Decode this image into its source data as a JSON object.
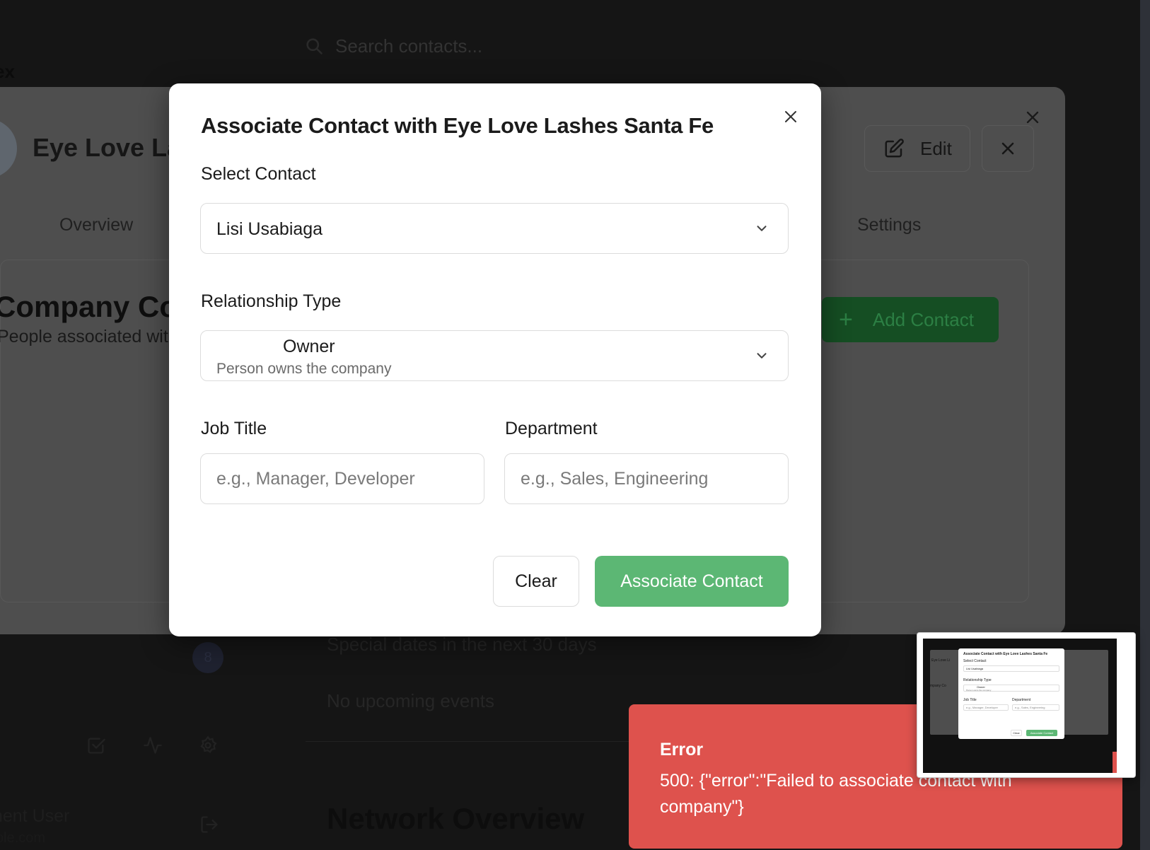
{
  "background": {
    "search_placeholder": "Search contacts...",
    "brand": "ex",
    "company_name": "Eye Love Las",
    "edit_label": "Edit",
    "tabs": [
      {
        "label": "Overview"
      },
      {
        "label": "Settings"
      }
    ],
    "section_title": "Company Co",
    "section_subtitle": "People associated wit",
    "add_contact_label": "Add Contact",
    "badge_count": "8",
    "special_dates_text": "Special dates in the next 30 days",
    "no_events_text": "No upcoming events",
    "network_title": "Network Overview",
    "user_name": "nent User",
    "user_email": "ple.com"
  },
  "modal": {
    "title": "Associate Contact with Eye Love Lashes Santa Fe",
    "select_contact_label": "Select Contact",
    "selected_contact": "Lisi Usabiaga",
    "relationship_type_label": "Relationship Type",
    "relationship_value": "Owner",
    "relationship_description": "Person owns the company",
    "job_title_label": "Job Title",
    "job_title_placeholder": "e.g., Manager, Developer",
    "job_title_value": "",
    "department_label": "Department",
    "department_placeholder": "e.g., Sales, Engineering",
    "department_value": "",
    "clear_label": "Clear",
    "associate_label": "Associate Contact"
  },
  "toast": {
    "title": "Error",
    "message": "500: {\"error\":\"Failed to associate contact with company\"}"
  },
  "thumbnail": {
    "title": "Associate Contact with Eye Love Lashes Santa Fe",
    "select_contact_label": "Select Contact",
    "selected_contact": "Lisi Usabiaga",
    "relationship_type_label": "Relationship Type",
    "relationship_value": "Owner",
    "relationship_description": "Person owns the company",
    "job_title_label": "Job Title",
    "department_label": "Department",
    "job_title_placeholder": "e.g., Manager, Developer",
    "department_placeholder": "e.g., Sales, Engineering",
    "clear_label": "Clear",
    "associate_label": "Associate Contact",
    "bg_company_name": "Eye Love Li",
    "bg_section_title": "mpany Co"
  },
  "colors": {
    "accent_green": "#5cb774",
    "error_red": "#de524d",
    "overlay_panel": "#4e4e4e"
  },
  "icons": {
    "search": "search-icon",
    "edit": "edit-icon",
    "close": "close-icon",
    "chevron": "chevron-down-icon",
    "plus": "plus-icon",
    "tasks": "checkbox-icon",
    "activity": "activity-icon",
    "settings": "gear-icon",
    "logout": "logout-icon"
  }
}
